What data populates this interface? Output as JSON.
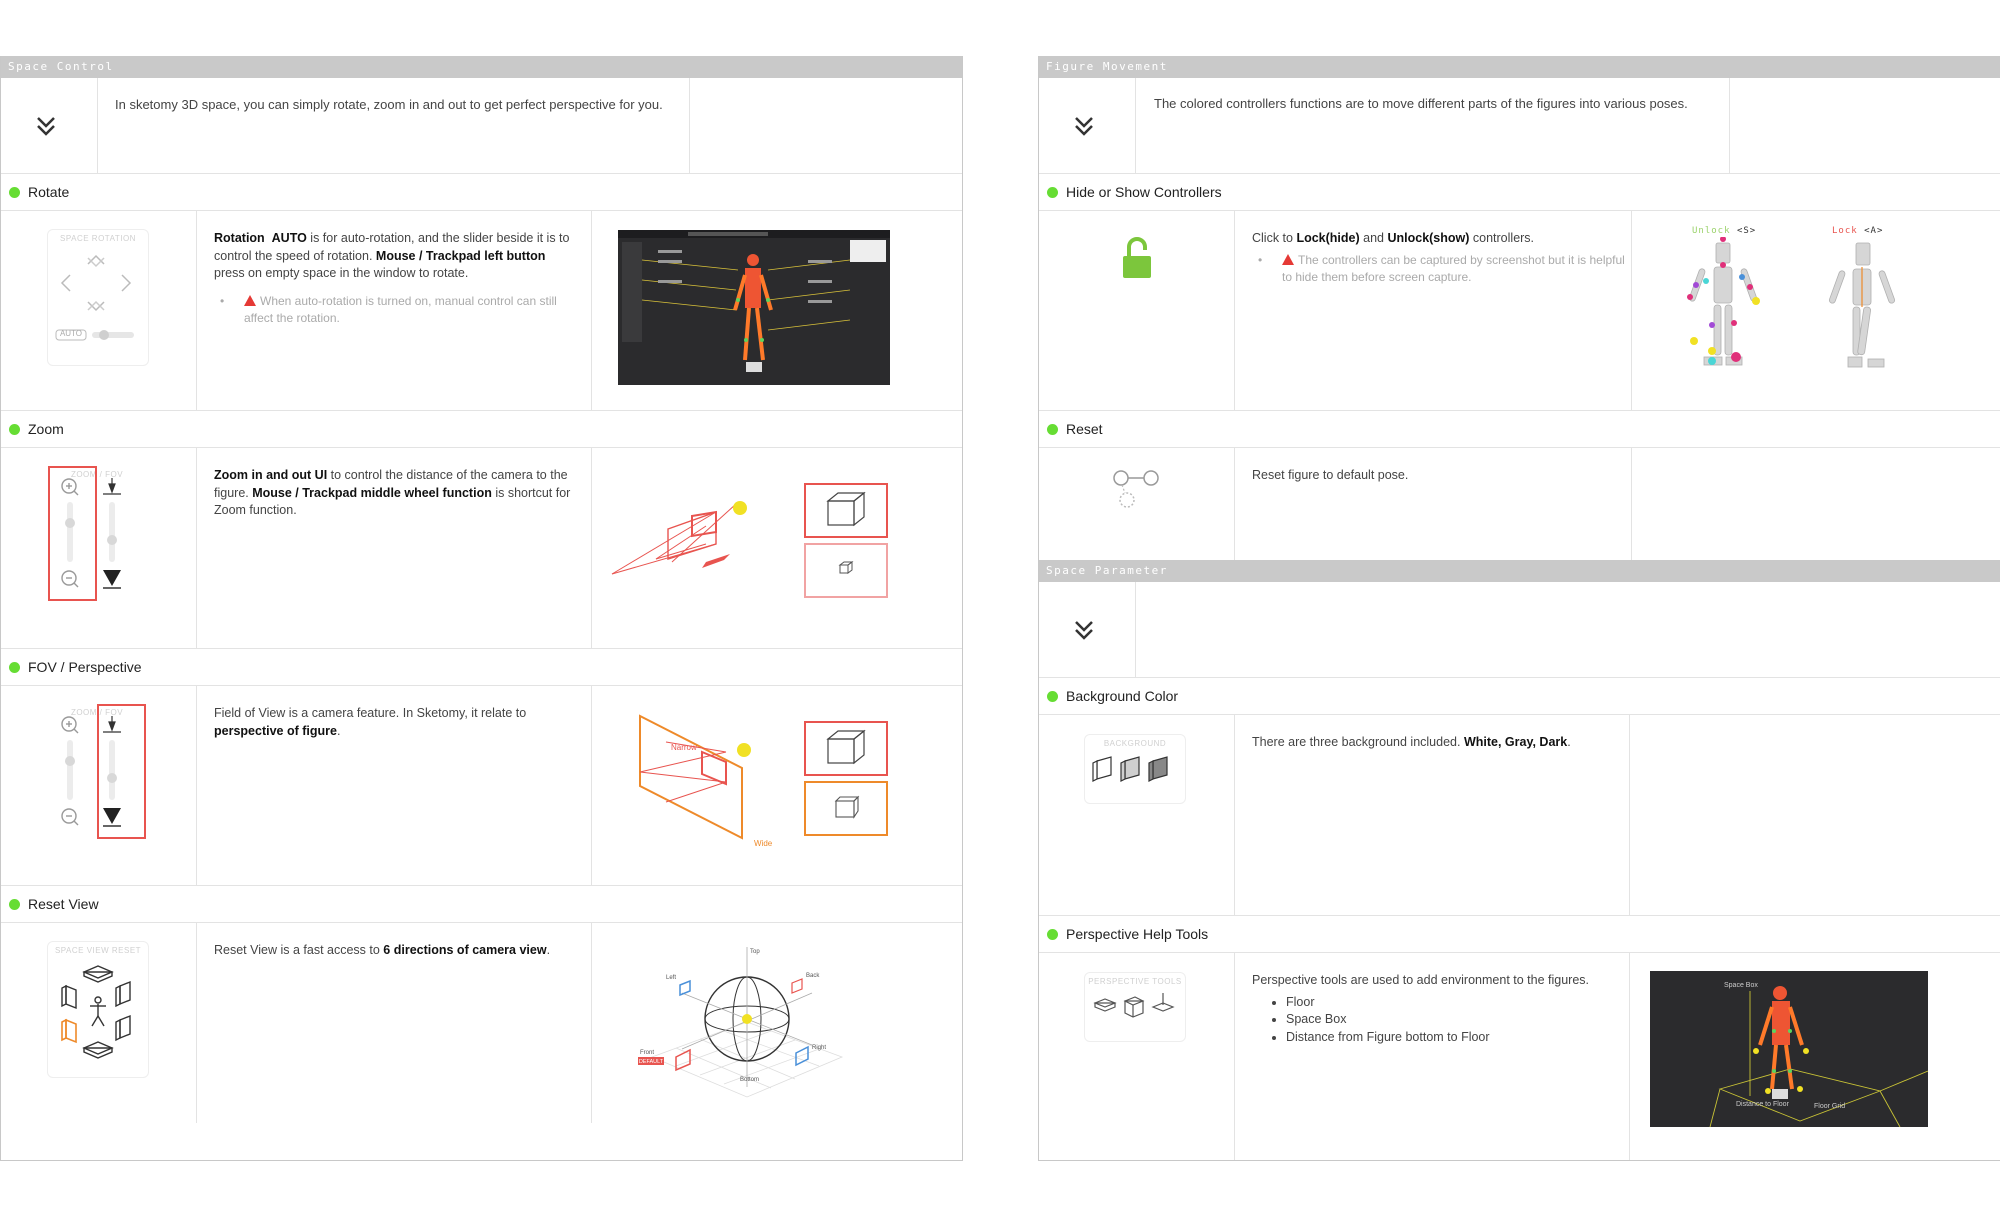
{
  "space_control": {
    "header": "Space Control",
    "intro": "In sketomy 3D space, you can simply rotate, zoom in and out to get perfect perspective for you.",
    "rotate": {
      "title": "Rotate",
      "widget_label": "SPACE ROTATION",
      "auto_label": "AUTO",
      "desc_b1": "Rotation",
      "desc_b2": "AUTO",
      "desc_t1": " is for auto-rotation, and the slider beside it is to control the speed of rotation. ",
      "desc_b3": "Mouse / Trackpad left button",
      "desc_t2": " press on empty space in the window to rotate.",
      "note": "When auto-rotation is turned on, manual control can still affect the rotation."
    },
    "zoom": {
      "title": "Zoom",
      "widget_label": "ZOOM / FOV",
      "desc_b1": "Zoom in and out UI",
      "desc_t1": " to control the distance of the camera to the figure. ",
      "desc_b2": "Mouse / Trackpad middle wheel function",
      "desc_t2": " is shortcut for Zoom function."
    },
    "fov": {
      "title": "FOV / Perspective",
      "widget_label": "ZOOM / FOV",
      "desc_t1": "Field of View is a camera feature. In Sketomy, it relate to ",
      "desc_b1": "perspective of figure",
      "desc_t2": ".",
      "narrow_label": "Narrow",
      "wide_label": "Wide"
    },
    "reset_view": {
      "title": "Reset View",
      "widget_label": "SPACE VIEW RESET",
      "desc_t1": "Reset View is a fast access to ",
      "desc_b1": "6 directions of camera view",
      "desc_t2": ".",
      "dir_top": "Top",
      "dir_back": "Back",
      "dir_left": "Left",
      "dir_right": "Right",
      "dir_front": "Front",
      "dir_bottom": "Bottom",
      "default_badge": "DEFAULT"
    }
  },
  "figure_movement": {
    "header": "Figure Movement",
    "intro": "The colored controllers functions are to move different parts of the figures into various poses.",
    "hide_show": {
      "title": "Hide or Show Controllers",
      "desc_t1": "Click to ",
      "desc_b1": "Lock(hide)",
      "desc_t2": " and ",
      "desc_b2": "Unlock(show)",
      "desc_t3": " controllers.",
      "note": "The controllers can be captured by screenshot but it is helpful to hide them before screen capture.",
      "unlock_label": "Unlock",
      "unlock_key": "<S>",
      "lock_label": "Lock",
      "lock_key": "<A>"
    },
    "reset": {
      "title": "Reset",
      "desc": "Reset figure to default pose."
    }
  },
  "space_parameter": {
    "header": "Space Parameter",
    "background": {
      "title": "Background Color",
      "widget_label": "BACKGROUND",
      "desc_t1": "There are three background included. ",
      "desc_b1": "White, Gray, Dark",
      "desc_t2": "."
    },
    "perspective": {
      "title": "Perspective Help Tools",
      "widget_label": "PERSPECTIVE TOOLS",
      "desc": "Perspective tools are used to add environment to the figures.",
      "items": [
        "Floor",
        "Space Box",
        "Distance from Figure bottom to Floor"
      ],
      "shot_label_box": "Space Box",
      "shot_label_dist": "Distance to Floor",
      "shot_label_grid": "Floor Grid"
    }
  },
  "colors": {
    "header_bar": "#c9c9c9",
    "bullet_green": "#66dd33",
    "lock_green": "#7cc63c",
    "zoom_red": "#e8544f",
    "fov_orange": "#ee8a2a"
  }
}
